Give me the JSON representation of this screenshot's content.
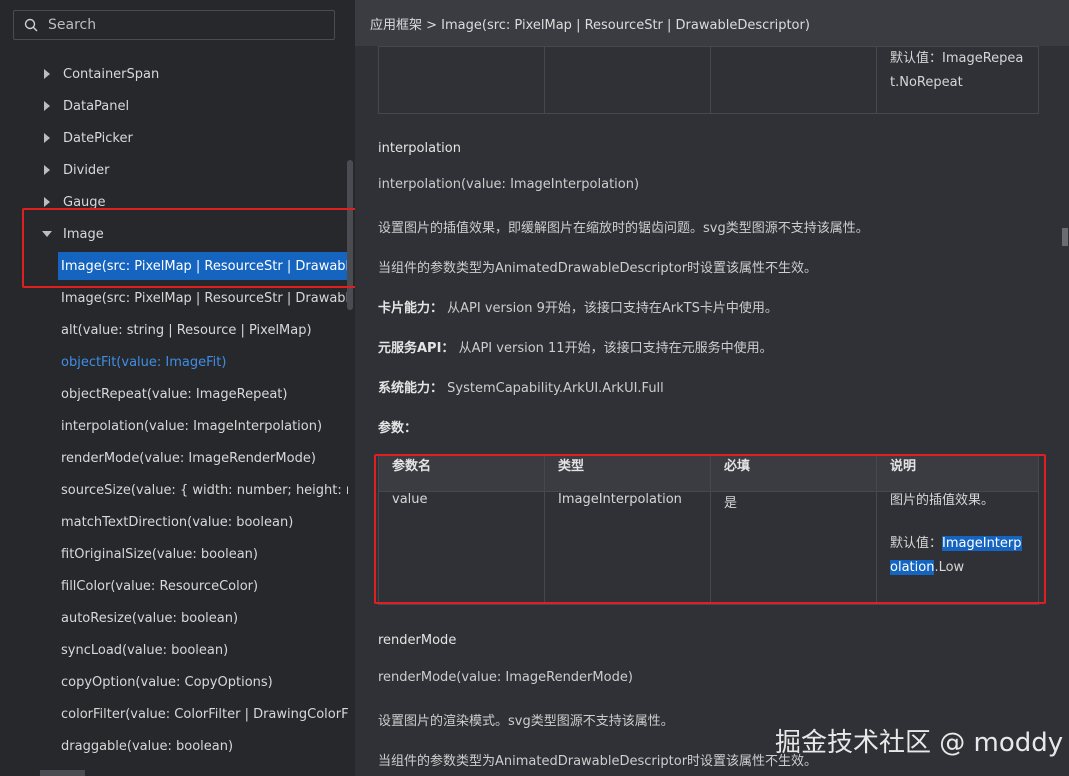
{
  "search": {
    "placeholder": "Search"
  },
  "tree": [
    {
      "label": "ContainerSpan",
      "type": "collapsed"
    },
    {
      "label": "DataPanel",
      "type": "collapsed"
    },
    {
      "label": "DatePicker",
      "type": "collapsed"
    },
    {
      "label": "Divider",
      "type": "collapsed"
    },
    {
      "label": "Gauge",
      "type": "collapsed"
    },
    {
      "label": "Image",
      "type": "expanded"
    },
    {
      "label": "Image(src: PixelMap | ResourceStr | DrawableDescriptor)",
      "type": "selected"
    },
    {
      "label": "Image(src: PixelMap | ResourceStr | DrawableDescriptor, imageAIOptions: ImageAIOptions)",
      "type": "leaf"
    },
    {
      "label": "alt(value: string | Resource | PixelMap)",
      "type": "leaf"
    },
    {
      "label": "objectFit(value: ImageFit)",
      "type": "active-link"
    },
    {
      "label": "objectRepeat(value: ImageRepeat)",
      "type": "leaf"
    },
    {
      "label": "interpolation(value: ImageInterpolation)",
      "type": "leaf"
    },
    {
      "label": "renderMode(value: ImageRenderMode)",
      "type": "leaf"
    },
    {
      "label": "sourceSize(value: { width: number; height: number })",
      "type": "leaf"
    },
    {
      "label": "matchTextDirection(value: boolean)",
      "type": "leaf"
    },
    {
      "label": "fitOriginalSize(value: boolean)",
      "type": "leaf"
    },
    {
      "label": "fillColor(value: ResourceColor)",
      "type": "leaf"
    },
    {
      "label": "autoResize(value: boolean)",
      "type": "leaf"
    },
    {
      "label": "syncLoad(value: boolean)",
      "type": "leaf"
    },
    {
      "label": "copyOption(value: CopyOptions)",
      "type": "leaf"
    },
    {
      "label": "colorFilter(value: ColorFilter | DrawingColorFilter)",
      "type": "leaf"
    },
    {
      "label": "draggable(value: boolean)",
      "type": "leaf"
    }
  ],
  "breadcrumb": "应用框架 > Image(src: PixelMap | ResourceStr | DrawableDescriptor)",
  "top_table": {
    "default_line1": "默认值：ImageRepea",
    "default_line2": "t.NoRepeat"
  },
  "interpolation": {
    "title": "interpolation",
    "signature": "interpolation(value: ImageInterpolation)",
    "desc1": "设置图片的插值效果，即缓解图片在缩放时的锯齿问题。svg类型图源不支持该属性。",
    "desc2": "当组件的参数类型为AnimatedDrawableDescriptor时设置该属性不生效。",
    "card_label": "卡片能力：",
    "card_text": "从API version 9开始，该接口支持在ArkTS卡片中使用。",
    "meta_label": "元服务API：",
    "meta_text": "从API version 11开始，该接口支持在元服务中使用。",
    "syscap_label": "系统能力：",
    "syscap_text": "SystemCapability.ArkUI.ArkUI.Full",
    "params_label": "参数："
  },
  "param_table": {
    "headers": [
      "参数名",
      "类型",
      "必填",
      "说明"
    ],
    "row": {
      "name": "value",
      "type": "ImageInterpolation",
      "required": "是",
      "desc": "图片的插值效果。",
      "default_prefix": "默认值：",
      "default_hl1": "ImageInterp",
      "default_hl2": "olation",
      "default_rest": ".Low"
    }
  },
  "render_mode": {
    "title": "renderMode",
    "signature": "renderMode(value: ImageRenderMode)",
    "desc1": "设置图片的渲染模式。svg类型图源不支持该属性。",
    "desc2": "当组件的参数类型为AnimatedDrawableDescriptor时设置该属性不生效。"
  },
  "watermark": "掘金技术社区 @ moddy",
  "colors": {
    "selected": "#1565c0",
    "link": "#3f8ee6",
    "annotation": "#e02020"
  }
}
